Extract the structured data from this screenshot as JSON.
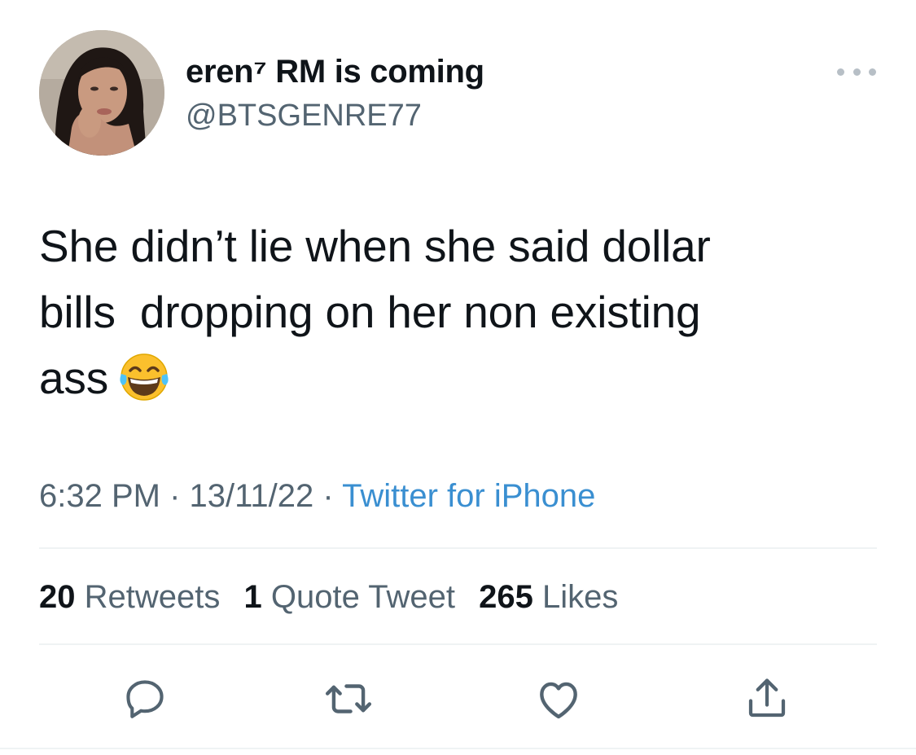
{
  "tweet": {
    "display_name": "eren⁷ RM is coming",
    "handle": "@BTSGENRE77",
    "text_lines": [
      "She didn’t lie when she said dollar",
      "bills  dropping on her non existing",
      "ass"
    ],
    "emoji": "face-with-tears-of-joy",
    "time": "6:32 PM",
    "date": "13/11/22",
    "separator": "·",
    "source": "Twitter for iPhone"
  },
  "stats": {
    "retweets_count": "20",
    "retweets_label": "Retweets",
    "quotes_count": "1",
    "quotes_label": "Quote Tweet",
    "likes_count": "265",
    "likes_label": "Likes"
  },
  "actions": [
    "reply-icon",
    "retweet-icon",
    "like-icon",
    "share-icon"
  ],
  "colors": {
    "text": "#0f1419",
    "secondary": "#536471",
    "link": "#3a8fd1",
    "icon": "#536471",
    "divider": "#eff3f4"
  }
}
